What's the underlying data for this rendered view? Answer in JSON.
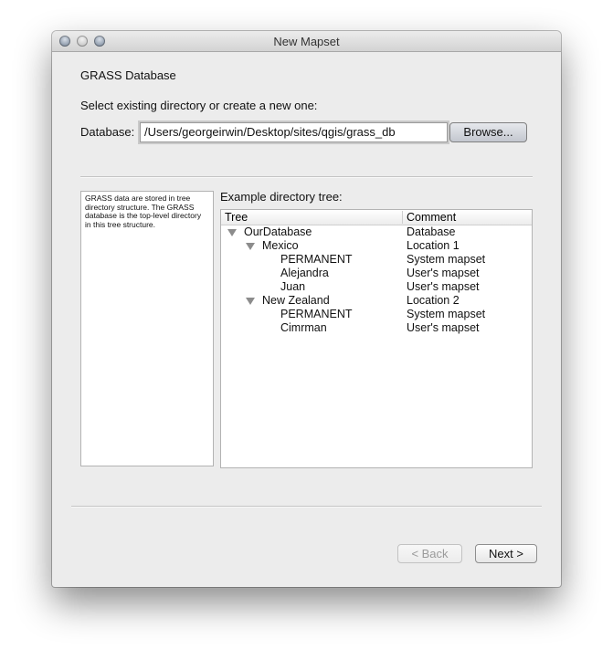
{
  "window": {
    "title": "New Mapset"
  },
  "page": {
    "heading": "GRASS Database",
    "instruction": "Select existing directory or create a new one:",
    "database_label": "Database:",
    "database_value": "/Users/georgeirwin/Desktop/sites/qgis/grass_db",
    "browse_label": "Browse...",
    "info_text": "GRASS data are stored in tree directory structure. The GRASS database is the top-level directory in this tree structure.",
    "tree_label": "Example directory tree:"
  },
  "tree": {
    "columns": [
      "Tree",
      "Comment"
    ],
    "rows": [
      {
        "name": "OurDatabase",
        "comment": "Database",
        "level": 0,
        "expanded": true
      },
      {
        "name": "Mexico",
        "comment": "Location 1",
        "level": 1,
        "expanded": true
      },
      {
        "name": "PERMANENT",
        "comment": "System mapset",
        "level": 2
      },
      {
        "name": "Alejandra",
        "comment": "User's mapset",
        "level": 2
      },
      {
        "name": "Juan",
        "comment": "User's mapset",
        "level": 2
      },
      {
        "name": "New Zealand",
        "comment": "Location 2",
        "level": 1,
        "expanded": true
      },
      {
        "name": "PERMANENT",
        "comment": "System mapset",
        "level": 2
      },
      {
        "name": "Cimrman",
        "comment": "User's mapset",
        "level": 2
      }
    ]
  },
  "footer": {
    "back_label": "< Back",
    "back_enabled": false,
    "next_label": "Next >"
  }
}
